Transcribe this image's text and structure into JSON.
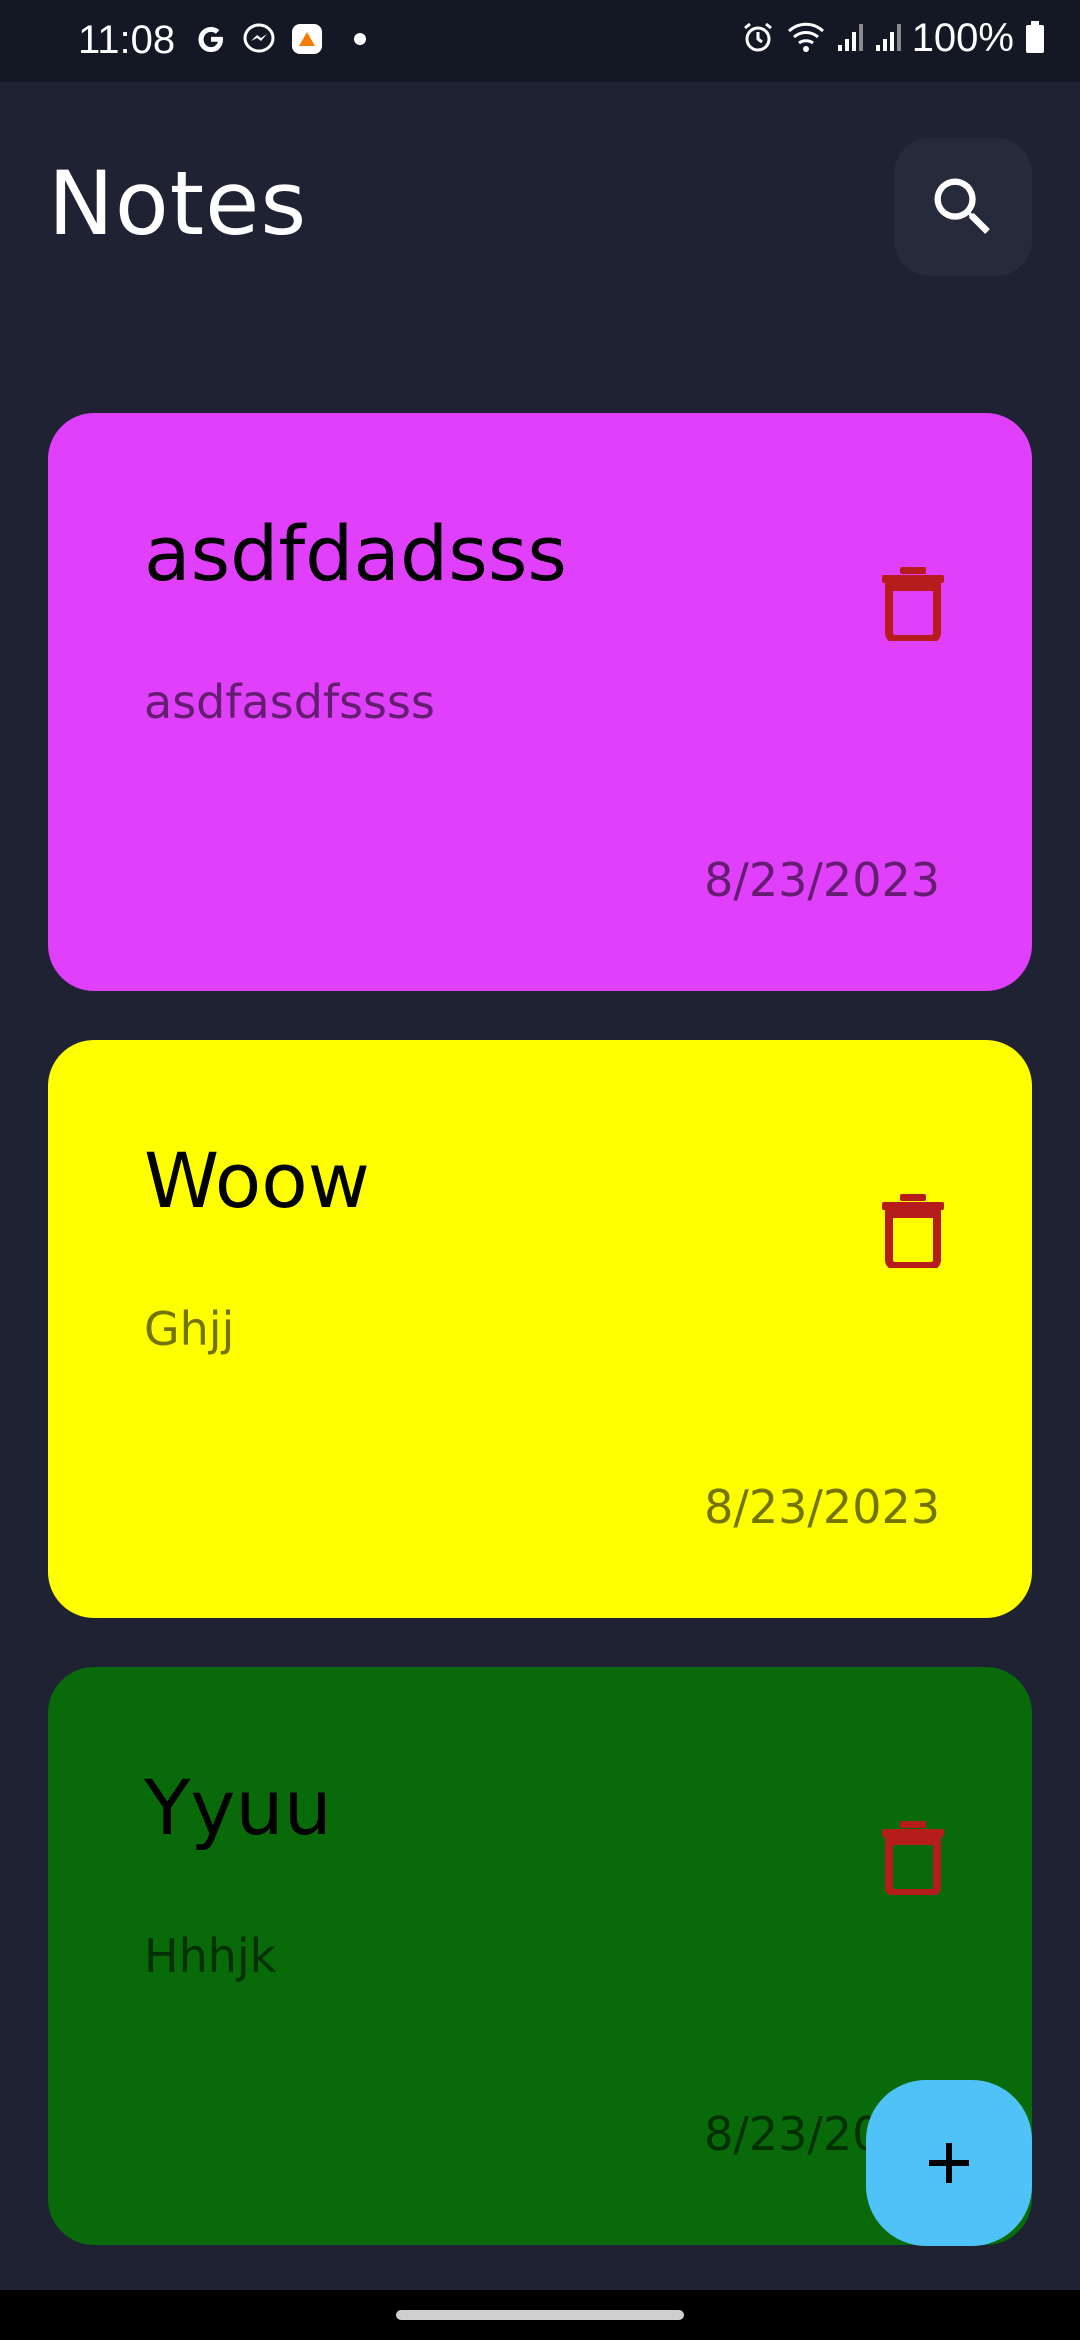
{
  "status_bar": {
    "time": "11:08",
    "battery": "100%",
    "left_icons": [
      "google-icon",
      "messenger-icon",
      "app-notification-icon"
    ],
    "right_icons": [
      "alarm-icon",
      "wifi-icon",
      "signal-icon",
      "signal-icon",
      "battery-icon"
    ]
  },
  "header": {
    "title": "Notes",
    "search_icon": "search-icon"
  },
  "notes": [
    {
      "title": "asdfdadsss",
      "body": "asdfasdfssss",
      "date": "8/23/2023",
      "color": "#e040fb"
    },
    {
      "title": "Woow",
      "body": "Ghjj",
      "date": "8/23/2023",
      "color": "#ffff00"
    },
    {
      "title": "Yyuu",
      "body": "Hhhjk",
      "date": "8/23/2023",
      "color": "#086a08"
    }
  ],
  "fab": {
    "icon": "plus-icon",
    "color": "#4fc3f7"
  },
  "colors": {
    "background": "#1e2233",
    "status_bar": "#141824",
    "delete_icon": "#b71c1c",
    "search_button": "#262b3b"
  }
}
